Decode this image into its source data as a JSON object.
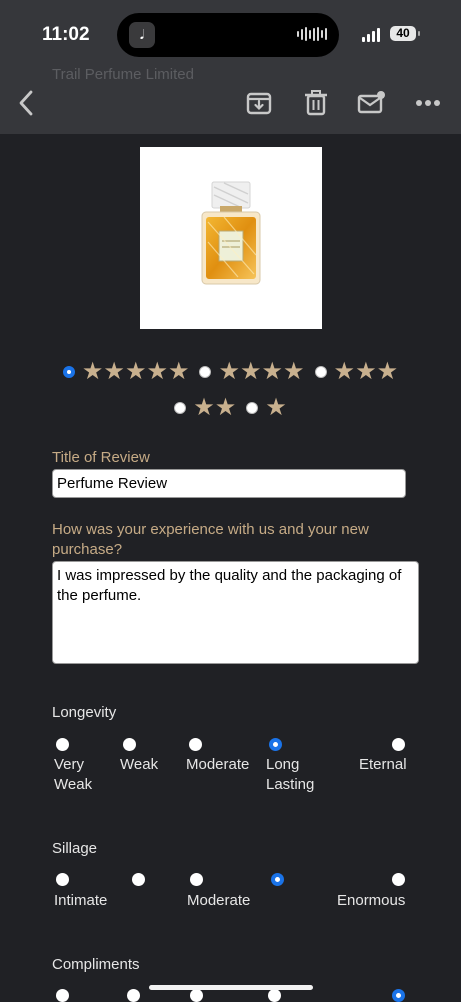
{
  "status": {
    "time": "11:02",
    "battery": "40",
    "island_app_glyph": "𝅘𝅥"
  },
  "nav": {
    "title": "Trail Perfume Limited",
    "icons": [
      "back-chevron-icon",
      "archive-icon",
      "trash-icon",
      "mail-unread-icon",
      "more-icon"
    ]
  },
  "rating": {
    "options": [
      {
        "stars": "★★★★★",
        "selected": true
      },
      {
        "stars": "★★★★",
        "selected": false
      },
      {
        "stars": "★★★",
        "selected": false
      },
      {
        "stars": "★★",
        "selected": false
      },
      {
        "stars": "★",
        "selected": false
      }
    ]
  },
  "review": {
    "title_label": "Title of Review",
    "title_value": "Perfume Review",
    "experience_label": "How was your experience with us and your new purchase?",
    "experience_value": "I was impressed by the quality and the packaging of the perfume."
  },
  "longevity": {
    "label": "Longevity",
    "options": [
      "Very Weak",
      "Weak",
      "Moderate",
      "Long Lasting",
      "Eternal"
    ],
    "selected": 3
  },
  "sillage": {
    "label": "Sillage",
    "labels": [
      "Intimate",
      "Moderate",
      "Enormous"
    ],
    "point_count": 6,
    "selected": 4
  },
  "compliments": {
    "label": "Compliments",
    "selected": 5
  },
  "colors": {
    "accent": "#1a73e8",
    "gold": "#c6ab86",
    "background": "#202125",
    "topbar": "#36373b"
  }
}
